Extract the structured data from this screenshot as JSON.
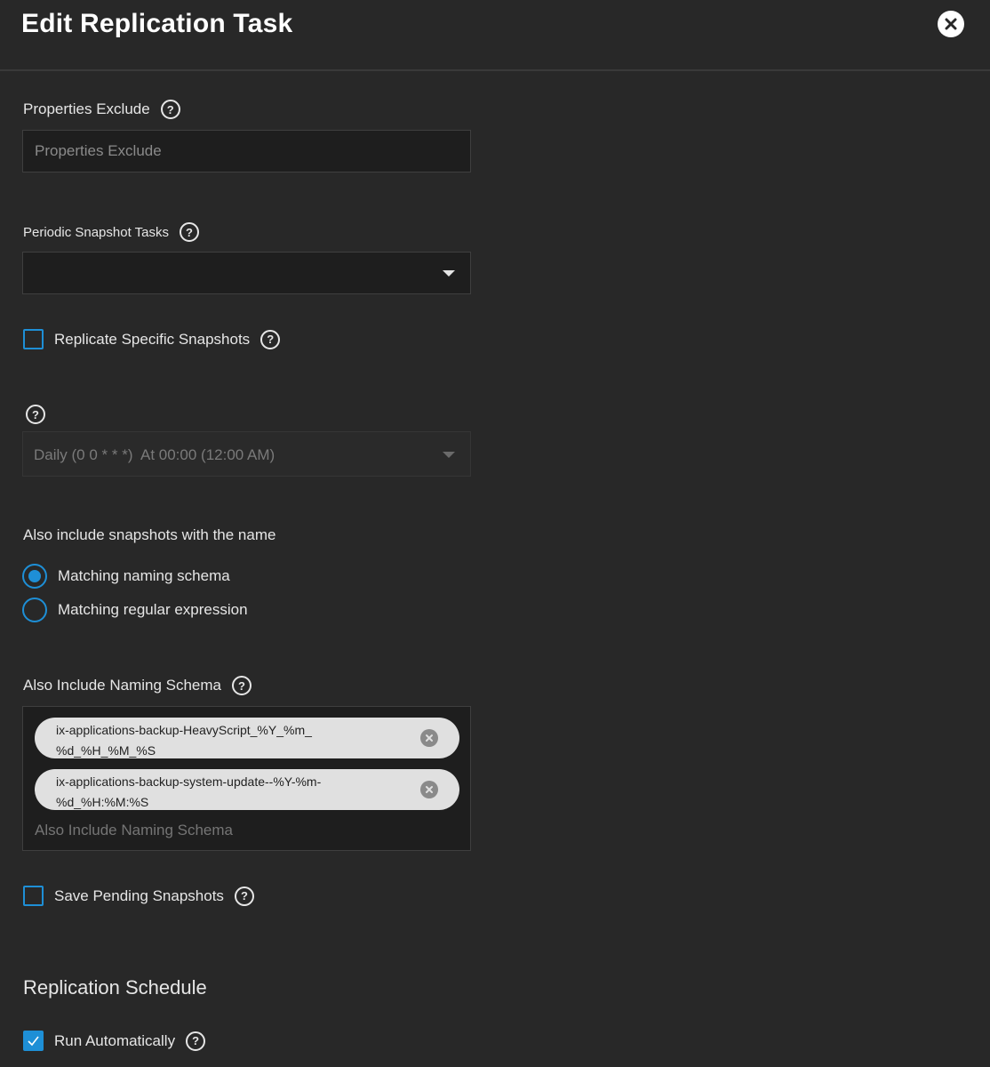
{
  "dialog": {
    "title": "Edit Replication Task"
  },
  "properties_exclude": {
    "label": "Properties Exclude",
    "placeholder": "Properties Exclude"
  },
  "periodic_snapshot_tasks": {
    "label": "Periodic Snapshot Tasks",
    "value": ""
  },
  "replicate_specific": {
    "label": "Replicate Specific Snapshots",
    "checked": false
  },
  "schedule_select": {
    "value": "Daily (0 0 * * *)  At 00:00 (12:00 AM)"
  },
  "also_include": {
    "label": "Also include snapshots with the name",
    "options": [
      {
        "label": "Matching naming schema",
        "selected": true
      },
      {
        "label": "Matching regular expression",
        "selected": false
      }
    ]
  },
  "naming_schema": {
    "label": "Also Include Naming Schema",
    "placeholder": "Also Include Naming Schema",
    "chips": [
      {
        "line1": "ix-applications-backup-HeavyScript_%Y_%m_",
        "line2": "%d_%H_%M_%S"
      },
      {
        "line1": "ix-applications-backup-system-update--%Y-%m-",
        "line2": "%d_%H:%M:%S"
      }
    ]
  },
  "save_pending": {
    "label": "Save Pending Snapshots",
    "checked": false
  },
  "replication_schedule": {
    "title": "Replication Schedule"
  },
  "run_automatically": {
    "label": "Run Automatically",
    "checked": true
  },
  "colors": {
    "accent": "#1e8fd6",
    "background": "#282828",
    "field": "#1e1e1e"
  },
  "icons": {
    "close": "close-icon",
    "help": "help-icon",
    "dropdown": "chevron-down-icon",
    "check": "check-icon"
  }
}
